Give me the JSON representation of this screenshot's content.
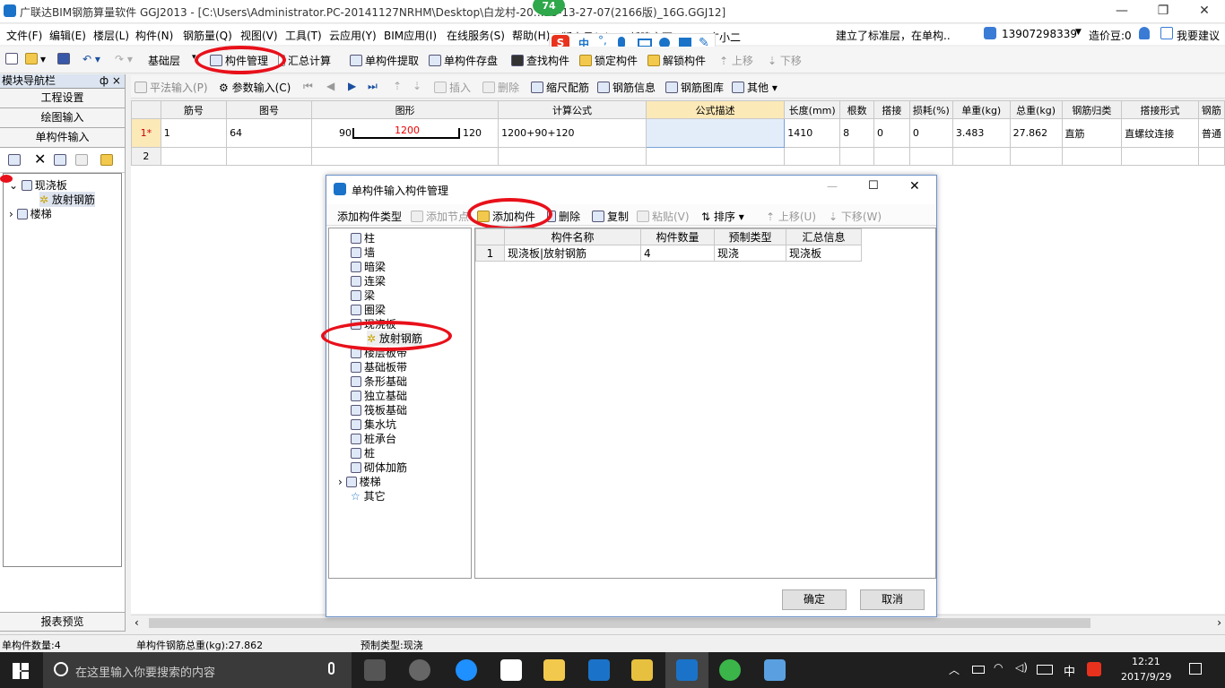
{
  "window": {
    "title": "广联达BIM钢筋算量软件 GGJ2013 - [C:\\Users\\Administrator.PC-20141127NRHM\\Desktop\\白龙村-20…25-13-27-07(2166版)_16G.GGJ12]",
    "badge": "74"
  },
  "menu": [
    "文件(F)",
    "编辑(E)",
    "楼层(L)",
    "构件(N)",
    "钢筋量(Q)",
    "视图(V)",
    "工具(T)",
    "云应用(Y)",
    "BIM应用(I)",
    "在线服务(S)",
    "帮助(H)",
    "版本号(B)",
    "新建变更",
    "广小二"
  ],
  "notice": "建立了标准层，在单构..",
  "account": {
    "phone": "13907298339",
    "beans": "造价豆:0",
    "suggest": "我要建议"
  },
  "toolbar": {
    "floor": "基础层",
    "component_mgr": "构件管理",
    "summary": "汇总计算",
    "extract": "单构件提取",
    "save": "单构件存盘",
    "find": "查找构件",
    "lock": "锁定构件",
    "unlock": "解锁构件",
    "up": "上移",
    "down": "下移"
  },
  "toolbar2": {
    "flat": "平法输入(P)",
    "param": "参数输入(C)",
    "insert": "插入",
    "delete": "删除",
    "scale": "缩尺配筋",
    "info": "钢筋信息",
    "library": "钢筋图库",
    "other": "其他"
  },
  "nav": {
    "title": "模块导航栏",
    "pin": "ф ×",
    "buttons": [
      "工程设置",
      "绘图输入",
      "单构件输入"
    ],
    "tree": {
      "root": "现浇板",
      "child": "放射钢筋",
      "stairs": "楼梯"
    },
    "report": "报表预览"
  },
  "grid": {
    "headers": [
      "",
      "筋号",
      "图号",
      "图形",
      "计算公式",
      "公式描述",
      "长度(mm)",
      "根数",
      "搭接",
      "损耗(%)",
      "单重(kg)",
      "总重(kg)",
      "钢筋归类",
      "搭接形式",
      "钢筋"
    ],
    "rows": [
      {
        "idx": "1*",
        "no": "1",
        "fig": "64",
        "shape_left": "90",
        "shape_mid": "1200",
        "shape_right": "120",
        "formula": "1200+90+120",
        "desc": "",
        "len": "1410",
        "count": "8",
        "lap": "0",
        "loss": "0",
        "unit": "3.483",
        "total": "27.862",
        "cls": "直筋",
        "laptype": "直螺纹连接",
        "type": "普通"
      },
      {
        "idx": "2"
      }
    ]
  },
  "dialog": {
    "title": "单构件输入构件管理",
    "toolbar": {
      "add_type": "添加构件类型",
      "add_node": "添加节点",
      "add_comp": "添加构件",
      "del": "删除",
      "copy": "复制",
      "paste": "粘贴(V)",
      "sort": "排序",
      "up": "上移(U)",
      "down": "下移(W)"
    },
    "tree": [
      "柱",
      "墙",
      "暗梁",
      "连梁",
      "梁",
      "圈梁",
      "现浇板",
      "放射钢筋",
      "楼层板带",
      "基础板带",
      "条形基础",
      "独立基础",
      "筏板基础",
      "集水坑",
      "桩承台",
      "桩",
      "砌体加筋",
      "楼梯",
      "其它"
    ],
    "table": {
      "headers": [
        "",
        "构件名称",
        "构件数量",
        "预制类型",
        "汇总信息"
      ],
      "row": [
        "1",
        "现浇板|放射钢筋",
        "4",
        "现浇",
        "现浇板"
      ]
    },
    "ok": "确定",
    "cancel": "取消"
  },
  "status": {
    "count": "单构件数量:4",
    "weight": "单构件钢筋总重(kg):27.862",
    "type": "预制类型:现浇"
  },
  "taskbar": {
    "search": "在这里输入你要搜索的内容",
    "time": "12:21",
    "date": "2017/9/29",
    "ime": "中"
  }
}
